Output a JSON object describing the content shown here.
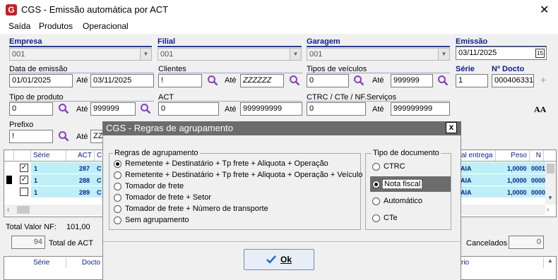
{
  "window": {
    "title": "CGS - Emissão automática por ACT",
    "close": "✕",
    "logo": "G"
  },
  "menu": [
    "Saída",
    "Produtos",
    "Operacional"
  ],
  "form": {
    "empresa_label": "Empresa",
    "empresa_value": "001",
    "filial_label": "Filial",
    "filial_value": "001",
    "garagem_label": "Garagem",
    "garagem_value": "001",
    "emissao_label": "Emissão",
    "emissao_value": "03/11/2025",
    "cal_icon": "15",
    "data_emissao_label": "Data de emissão",
    "data_emissao_from": "01/01/2025",
    "ate": "Até",
    "data_emissao_to": "03/11/2025",
    "clientes_label": "Clientes",
    "clientes_from": "!",
    "clientes_to": "ZZZZZZ",
    "tipos_veiculos_label": "Tipos de veículos",
    "tipos_veiculos_from": "0",
    "tipos_veiculos_to": "999999",
    "serie_label": "Série",
    "serie_value": "1",
    "ndocto_label": "Nº Docto",
    "ndocto_value": "000406331",
    "plus": "+",
    "tipo_produto_label": "Tipo de produto",
    "tipo_produto_from": "0",
    "tipo_produto_to": "999999",
    "act_label": "ACT",
    "act_from": "0",
    "act_to": "999999999",
    "ctrc_label": "CTRC / CTe / NF.Serviços",
    "ctrc_from": "0",
    "ctrc_to": "999999999",
    "font_icon": "AA",
    "prefixo_label": "Prefixo",
    "prefixo_from": "!",
    "prefixo_to": "ZZ"
  },
  "grid": {
    "headers": [
      "",
      "",
      "Série",
      "ACT",
      "C"
    ],
    "right_headers": [
      "al entrega",
      "Peso",
      "N"
    ],
    "rows": [
      {
        "checked": true,
        "serie": "1",
        "act": "287",
        "c": "C",
        "entrega": "AIA",
        "peso": "1,0000",
        "n": "0001"
      },
      {
        "checked": true,
        "serie": "1",
        "act": "288",
        "c": "C",
        "entrega": "AIA",
        "peso": "1,0000",
        "n": "0000"
      },
      {
        "checked": false,
        "serie": "1",
        "act": "289",
        "c": "C",
        "entrega": "AIA",
        "peso": "1,0000",
        "n": "0000"
      }
    ]
  },
  "totals": {
    "total_nf_label": "Total Valor NF:",
    "total_nf_value": "101,00",
    "act_count": "94",
    "total_act_label": "Total de ACT",
    "cancelados_label": "Cancelados",
    "cancelados_value": "0"
  },
  "grid2": {
    "headers": [
      "Série",
      "Docto"
    ],
    "right_header": "rio"
  },
  "modal": {
    "title": "CGS - Regras de agrupamento",
    "close": "x",
    "group1_title": "Regras de agrupamento",
    "options": [
      "Remetente + Destinatário + Tp frete + Aliquota + Operação",
      "Remetente + Destinatário + Tp frete + Aliquota + Operação + Veículo",
      "Tomador de frete",
      "Tomador de frete + Setor",
      "Tomador de frete + Número de transporte",
      "Sem agrupamento"
    ],
    "selected_option": 0,
    "group2_title": "Tipo de documento",
    "doc_types": [
      "CTRC",
      "Nota fiscal",
      "Automático",
      "CTe"
    ],
    "selected_doc": 1,
    "ok_label": "Ok"
  }
}
